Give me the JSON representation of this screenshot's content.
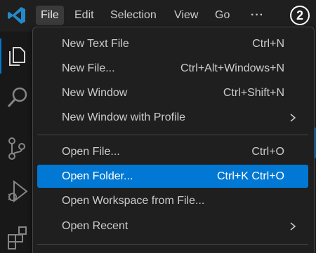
{
  "menubar": {
    "items": [
      "File",
      "Edit",
      "Selection",
      "View",
      "Go",
      "···"
    ],
    "active": "File"
  },
  "step_badge": "②",
  "file_menu": {
    "items": [
      {
        "label": "New Text File",
        "shortcut": "Ctrl+N"
      },
      {
        "label": "New File...",
        "shortcut": "Ctrl+Alt+Windows+N"
      },
      {
        "label": "New Window",
        "shortcut": "Ctrl+Shift+N"
      },
      {
        "label": "New Window with Profile",
        "shortcut": "",
        "submenu": true
      },
      {
        "label": "Open File...",
        "shortcut": "Ctrl+O"
      },
      {
        "label": "Open Folder...",
        "shortcut": "Ctrl+K Ctrl+O",
        "highlighted": true
      },
      {
        "label": "Open Workspace from File...",
        "shortcut": ""
      },
      {
        "label": "Open Recent",
        "shortcut": "",
        "submenu": true
      }
    ]
  },
  "activity_bar": {
    "icons": [
      "explorer-icon",
      "search-icon",
      "source-control-icon",
      "run-debug-icon",
      "extensions-icon"
    ]
  },
  "colors": {
    "accent": "#0078d4",
    "menu_bg": "#1f1f1f",
    "text": "#cccccc",
    "logo": "#2489ca"
  }
}
